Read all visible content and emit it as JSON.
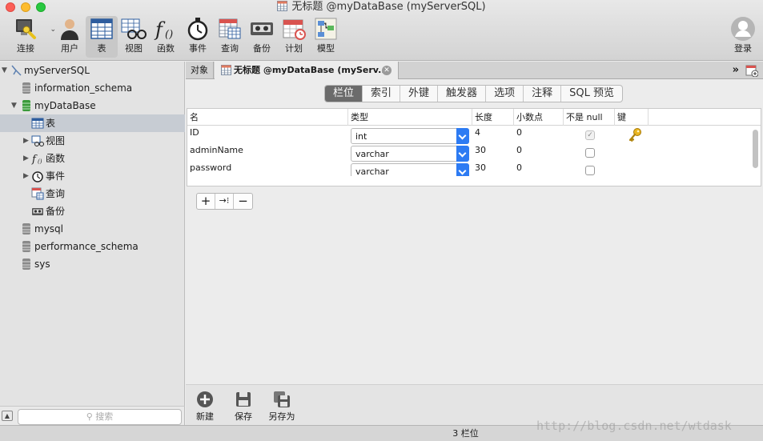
{
  "window": {
    "title": "无标题 @myDataBase (myServerSQL)"
  },
  "toolbar": {
    "connect": "连接",
    "user": "用户",
    "table": "表",
    "view": "视图",
    "function": "函数",
    "event": "事件",
    "query": "查询",
    "backup": "备份",
    "schedule": "计划",
    "model": "模型",
    "login": "登录"
  },
  "sidebar": {
    "server": "myServerSQL",
    "items": [
      {
        "label": "information_schema"
      },
      {
        "label": "myDataBase"
      },
      {
        "label": "表"
      },
      {
        "label": "视图"
      },
      {
        "label": "函数"
      },
      {
        "label": "事件"
      },
      {
        "label": "查询"
      },
      {
        "label": "备份"
      },
      {
        "label": "mysql"
      },
      {
        "label": "performance_schema"
      },
      {
        "label": "sys"
      }
    ],
    "search_placeholder": "搜索"
  },
  "tabs": {
    "objects": "对象",
    "document": "无标题 @myDataBase (myServ...",
    "more": "»"
  },
  "segments": [
    "栏位",
    "索引",
    "外键",
    "触发器",
    "选项",
    "注释",
    "SQL 预览"
  ],
  "table": {
    "headers": [
      "名",
      "类型",
      "长度",
      "小数点",
      "不是 null",
      "键"
    ],
    "rows": [
      {
        "name": "ID",
        "type": "int",
        "length": "4",
        "decimals": "0",
        "not_null": true,
        "key": true
      },
      {
        "name": "adminName",
        "type": "varchar",
        "length": "30",
        "decimals": "0",
        "not_null": false,
        "key": false
      },
      {
        "name": "password",
        "type": "varchar",
        "length": "30",
        "decimals": "0",
        "not_null": false,
        "key": false
      }
    ]
  },
  "grid_buttons": {
    "add": "+",
    "insert": "→⁝",
    "remove": "−"
  },
  "bottom_actions": {
    "new": "新建",
    "save": "保存",
    "save_as": "另存为"
  },
  "status": {
    "text": "3 栏位"
  },
  "watermark": "http://blog.csdn.net/wtdask",
  "colors": {
    "accent": "#2d7bf3",
    "selected_segment": "#6b6b6b",
    "db_icon_green": "#3a9a3a",
    "db_icon_gray": "#8a8a8a"
  }
}
